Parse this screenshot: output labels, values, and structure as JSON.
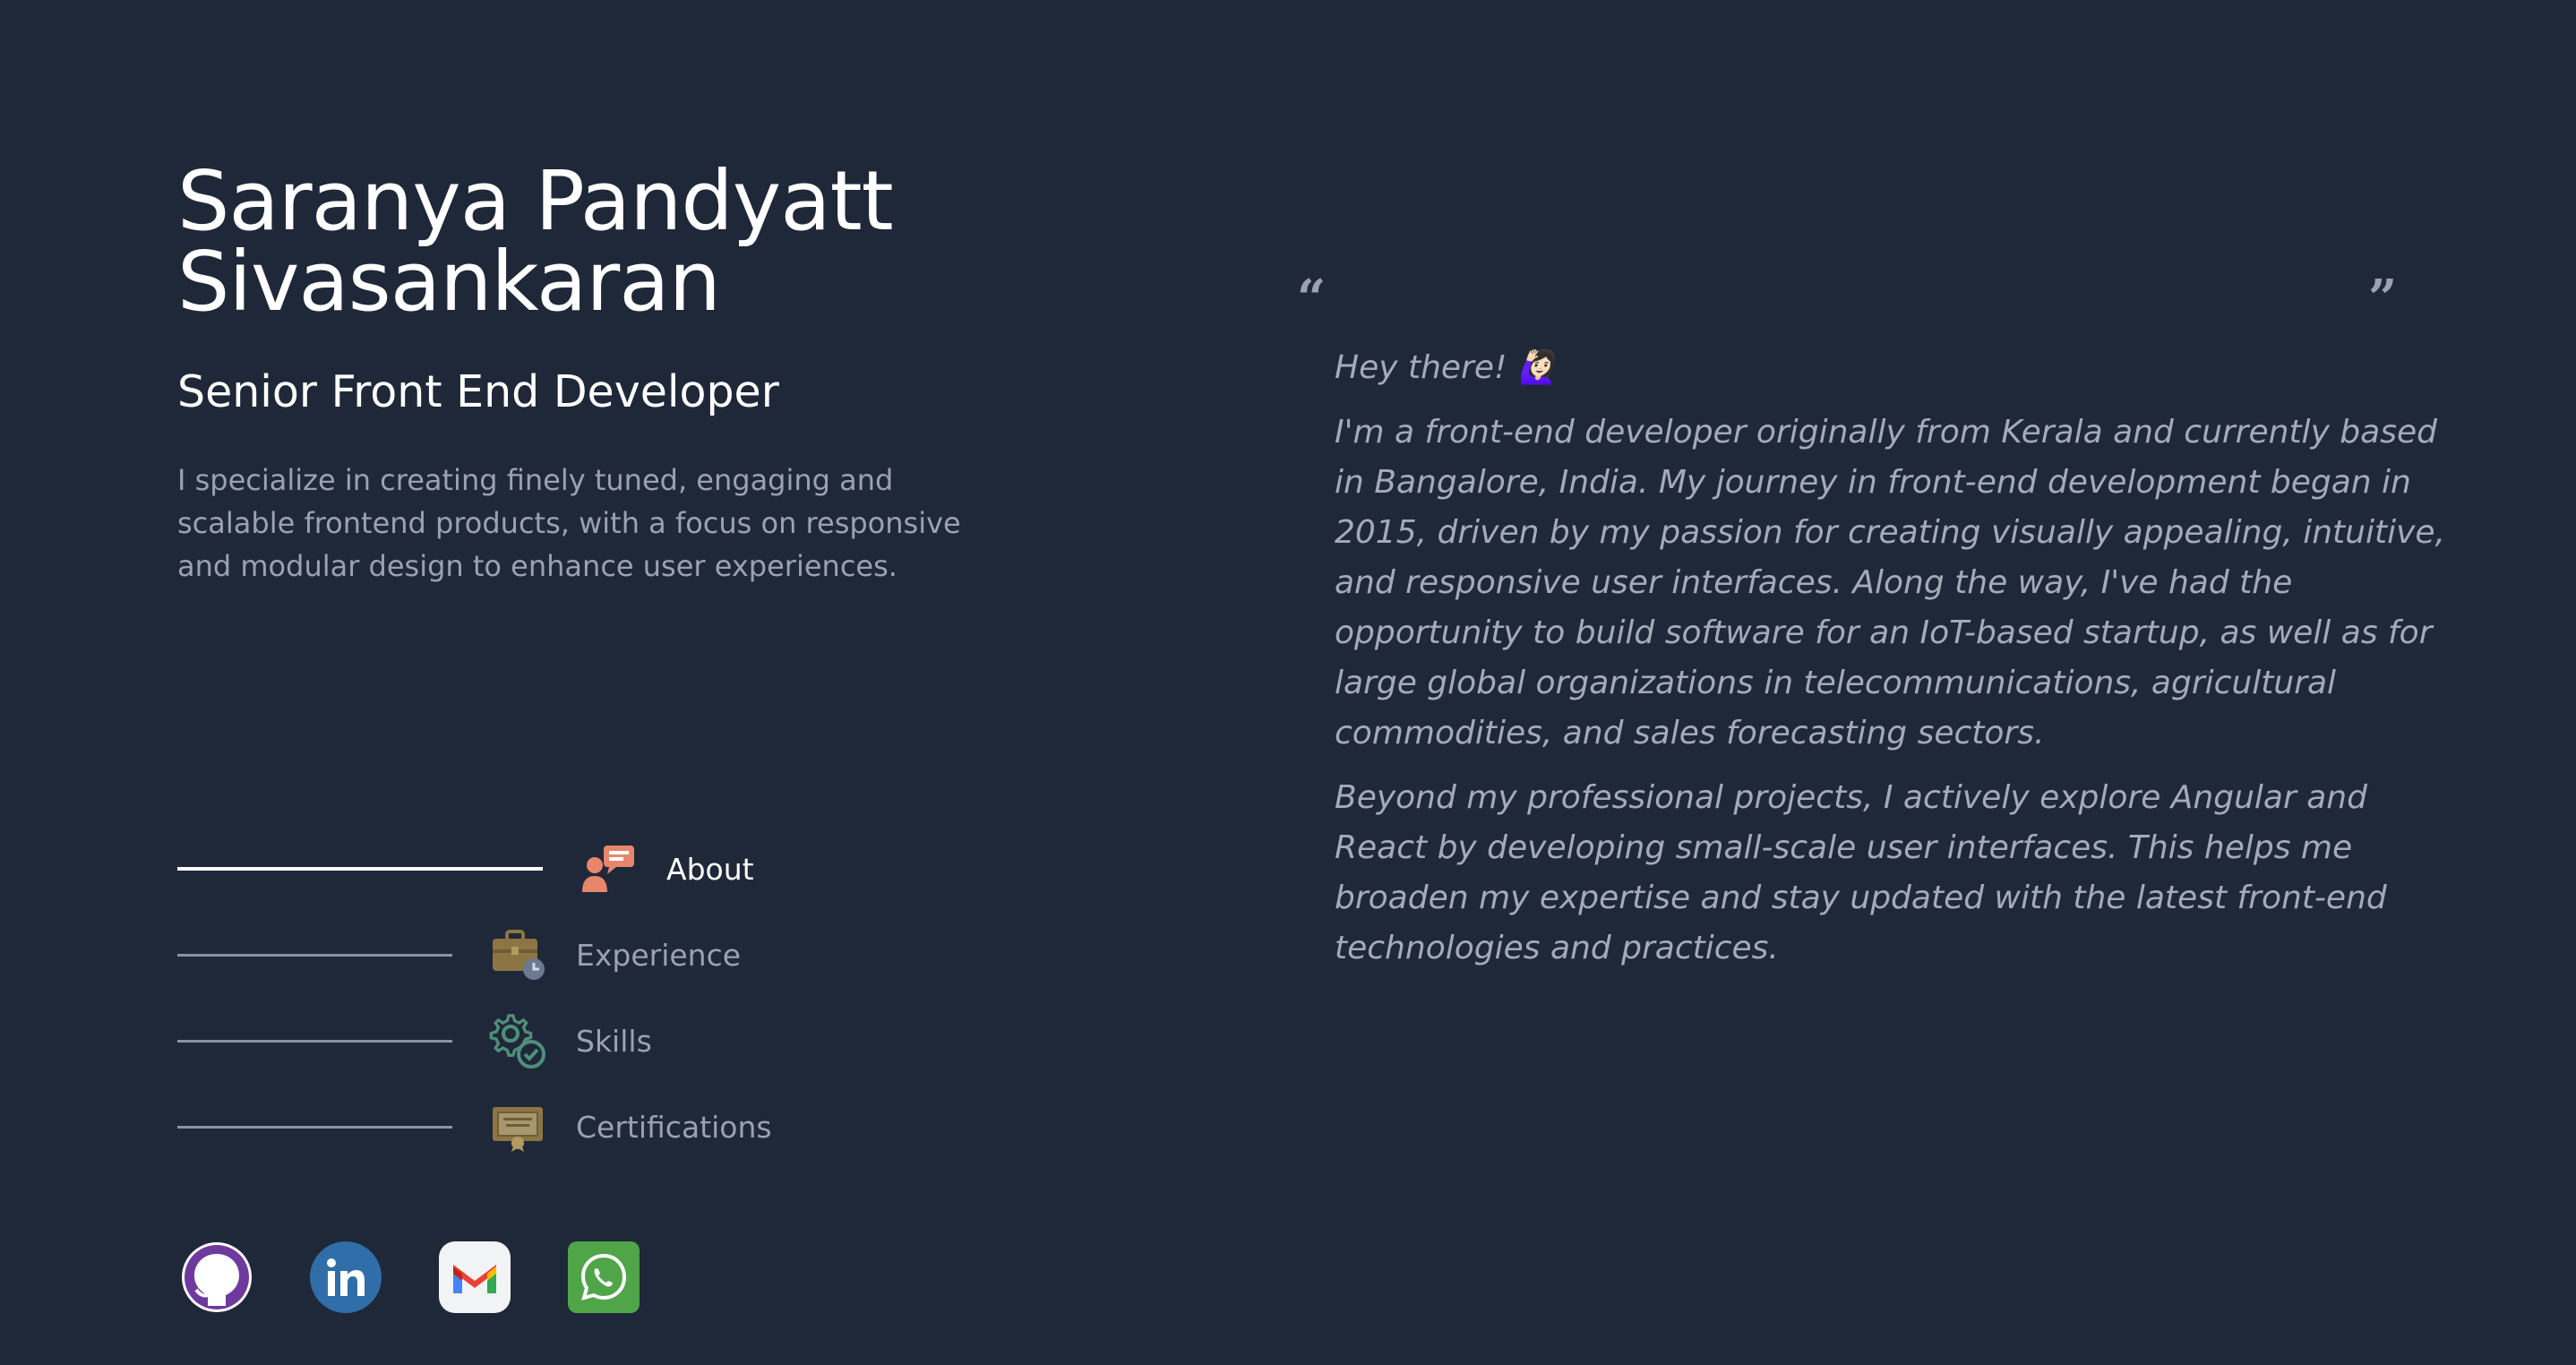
{
  "profile": {
    "name_line1": "Saranya Pandyatt",
    "name_line2": "Sivasankaran",
    "role": "Senior Front End Developer",
    "summary": "I specialize in creating finely tuned, engaging and scalable frontend products, with a focus on responsive and modular design to enhance user experiences."
  },
  "nav": {
    "items": [
      {
        "label": "About",
        "icon": "about-icon",
        "active": true
      },
      {
        "label": "Experience",
        "icon": "briefcase-icon",
        "active": false
      },
      {
        "label": "Skills",
        "icon": "gear-check-icon",
        "active": false
      },
      {
        "label": "Certifications",
        "icon": "certificate-icon",
        "active": false
      }
    ]
  },
  "social": {
    "items": [
      {
        "name": "GitHub",
        "icon": "github-icon"
      },
      {
        "name": "LinkedIn",
        "icon": "linkedin-icon"
      },
      {
        "name": "Gmail",
        "icon": "gmail-icon"
      },
      {
        "name": "WhatsApp",
        "icon": "whatsapp-icon"
      }
    ]
  },
  "quote": {
    "open_mark": "“",
    "close_mark": "”",
    "greeting": "Hey there!",
    "greeting_emoji": "🙋🏻‍♀️",
    "paragraph1": "I'm a front-end developer originally from Kerala and currently based in Bangalore, India. My journey in front-end development began in 2015, driven by my passion for creating visually appealing, intuitive, and responsive user interfaces. Along the way, I've had the opportunity to build software for an IoT-based startup, as well as for large global organizations in telecommunications, agricultural commodities, and sales forecasting sectors.",
    "paragraph2": "Beyond my professional projects, I actively explore Angular and React by developing small-scale user interfaces. This helps me broaden my expertise and stay updated with the latest front-end technologies and practices."
  },
  "colors": {
    "background": "#1f2838",
    "text_primary": "#ffffff",
    "text_muted": "#9aa2b0",
    "github": "#6e3a9e",
    "linkedin": "#2f6ea8",
    "whatsapp": "#4fa548"
  }
}
